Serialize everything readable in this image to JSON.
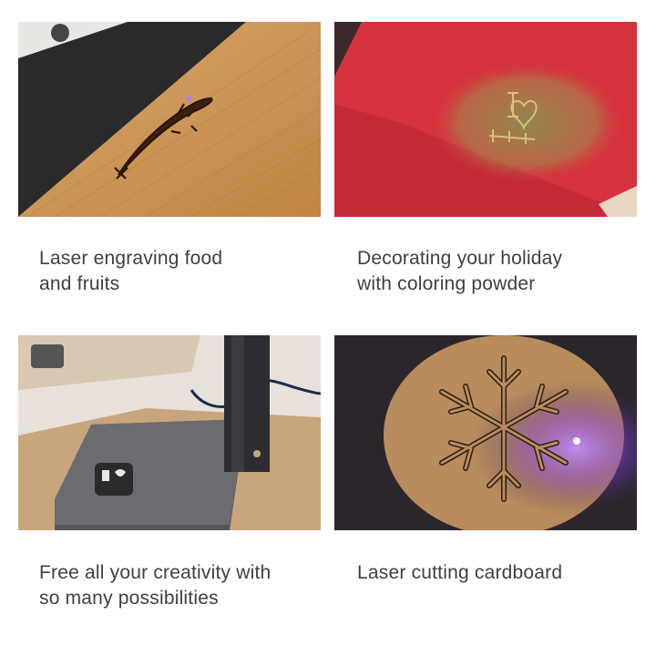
{
  "tiles": [
    {
      "scene": "wood-board-fish-engraving",
      "caption_lines": [
        "Laser engraving food",
        "and fruits"
      ],
      "colors": {
        "wood": "#c9934e",
        "base": "#2b2b2e"
      }
    },
    {
      "scene": "red-card-coloring-powder",
      "caption_lines": [
        "Decorating your holiday",
        "with coloring powder"
      ],
      "colors": {
        "card": "#d8323f",
        "powder": "#9a8a4a"
      }
    },
    {
      "scene": "engraver-on-stand",
      "caption_lines": [
        "Free all your creativity with",
        "so many possibilities"
      ],
      "colors": {
        "stand": "#4a4a4f",
        "desk": "#c8a37a"
      }
    },
    {
      "scene": "cardboard-snowflake-cut",
      "caption_lines": [
        "Laser cutting cardboard"
      ],
      "colors": {
        "cardboard": "#b98c5e",
        "laser": "#a155ff"
      }
    }
  ]
}
